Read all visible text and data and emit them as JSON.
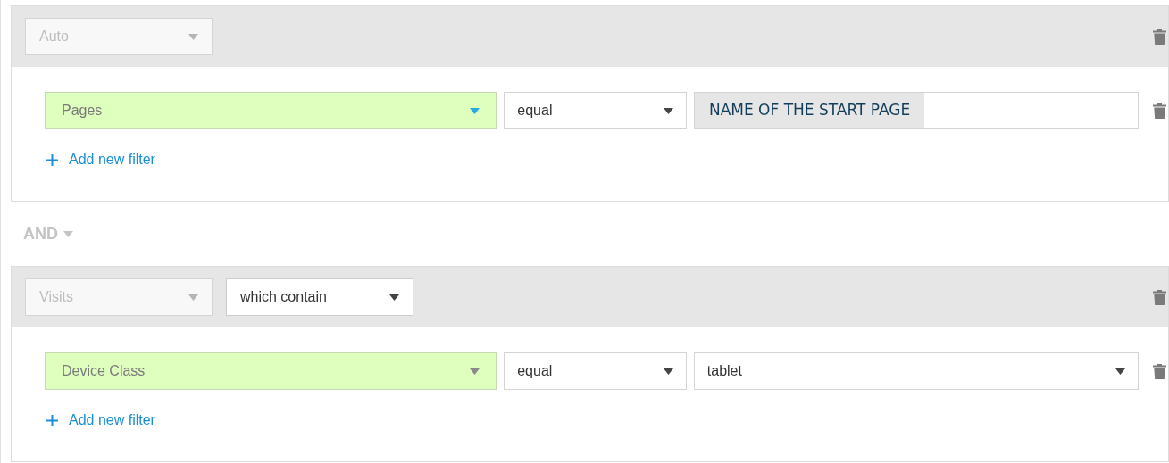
{
  "groups": [
    {
      "scope": {
        "value": "Auto",
        "disabled": true
      },
      "filters": [
        {
          "dimension": {
            "value": "Pages",
            "focused": true
          },
          "operator": "equal",
          "value": {
            "kind": "token",
            "text": "NAME OF THE START PAGE"
          }
        }
      ],
      "add_label": "Add new filter"
    },
    {
      "scope": {
        "value": "Visits",
        "disabled": true
      },
      "mode": "which contain",
      "filters": [
        {
          "dimension": {
            "value": "Device Class",
            "focused": false
          },
          "operator": "equal",
          "value": {
            "kind": "select",
            "text": "tablet"
          }
        }
      ],
      "add_label": "Add new filter"
    }
  ],
  "joins": [
    "AND"
  ]
}
